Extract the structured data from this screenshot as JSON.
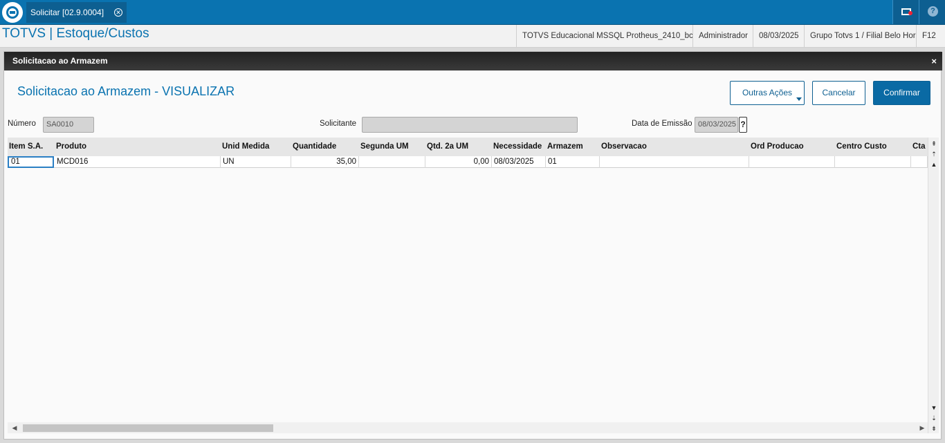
{
  "topbar": {
    "tab_label": "Solicitar [02.9.0004]",
    "tab_close": "✕",
    "help_glyph": "?"
  },
  "header": {
    "app_title": "TOTVS | Estoque/Custos",
    "environment": "TOTVS Educacional MSSQL Protheus_2410_bc",
    "user": "Administrador",
    "date": "08/03/2025",
    "branch": "Grupo Totvs 1 / Filial Belo Hor",
    "shortcut": "F12"
  },
  "dialog": {
    "title": "Solicitacao ao Armazem",
    "close": "×",
    "view_title": "Solicitacao ao Armazem - VISUALIZAR",
    "buttons": {
      "other_actions": "Outras Ações",
      "cancel": "Cancelar",
      "confirm": "Confirmar"
    },
    "fields": {
      "numero_label": "Número",
      "numero_value": "SA0010",
      "solicitante_label": "Solicitante",
      "solicitante_value": "",
      "emissao_label": "Data de Emissão",
      "emissao_value": "08/03/2025",
      "lookup": "?"
    }
  },
  "grid": {
    "columns": [
      "Item S.A.",
      "Produto",
      "Unid Medida",
      "Quantidade",
      "Segunda UM",
      "Qtd. 2a UM",
      "Necessidade",
      "Armazem",
      "Observacao",
      "Ord Producao",
      "Centro Custo",
      "Cta"
    ],
    "rows": [
      [
        "01",
        "MCD016",
        "UN",
        "35,00",
        "",
        "0,00",
        "08/03/2025",
        "01",
        "",
        "",
        "",
        ""
      ]
    ]
  },
  "scroll": {
    "top": "⇞",
    "page_up": "⇡",
    "up": "▲",
    "down": "▼",
    "page_down": "⇣",
    "bottom": "⇟",
    "left": "◀",
    "right": "▶"
  }
}
